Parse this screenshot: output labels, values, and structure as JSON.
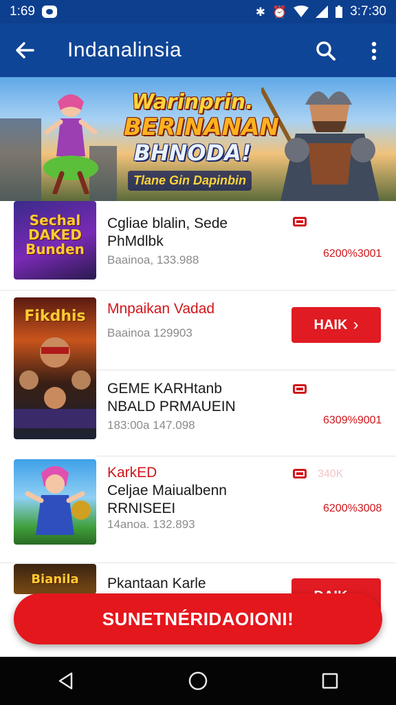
{
  "status_bar": {
    "time": "1:69",
    "clock": "3:7:30",
    "icons": [
      "notification-icon",
      "bluetooth-icon",
      "alarm-icon",
      "wifi-icon",
      "signal-icon",
      "battery-icon"
    ]
  },
  "app_bar": {
    "title": "Indanalinsia",
    "icons": [
      "back-arrow-icon",
      "search-icon",
      "more-vert-icon"
    ]
  },
  "banner": {
    "line1": "Warinprin.",
    "line2": "BERINANAN",
    "line3": "BHNODA!",
    "tagline": "Tlane Gin Dapinbin"
  },
  "games": [
    {
      "thumb_text": "Sechal DAKED Bunden",
      "name": "Cgliae blalin, Sede PhMdlbk",
      "meta": "Baainoa, 133.988",
      "price": "6200%3001"
    },
    {
      "thumb_text": "Fikdhis",
      "name": "Mnpaikan Vadad",
      "meta": "Baainoa 129903",
      "cta": "HAIK"
    },
    {
      "name": "GEME KARHtanb NBALD PRMAUEIN",
      "meta": "183:00a 147.098",
      "price": "6309%9001"
    },
    {
      "label": "KarkED",
      "name": "Celjae Maiualbenn RRNISEEI",
      "meta": "14anoa. 132.893",
      "price": "6200%3008",
      "faint": "340K"
    },
    {
      "thumb_text": "Bianila",
      "name": "Pkantaan Karle",
      "cta": "DAIK"
    }
  ],
  "action_button": {
    "label": "SUNETNÉRIDAOIONI!"
  },
  "nav_bar": {
    "icons": [
      "back-triangle-icon",
      "home-circle-icon",
      "recents-square-icon"
    ]
  },
  "colors": {
    "primary": "#0f4596",
    "accent": "#e01b22"
  }
}
